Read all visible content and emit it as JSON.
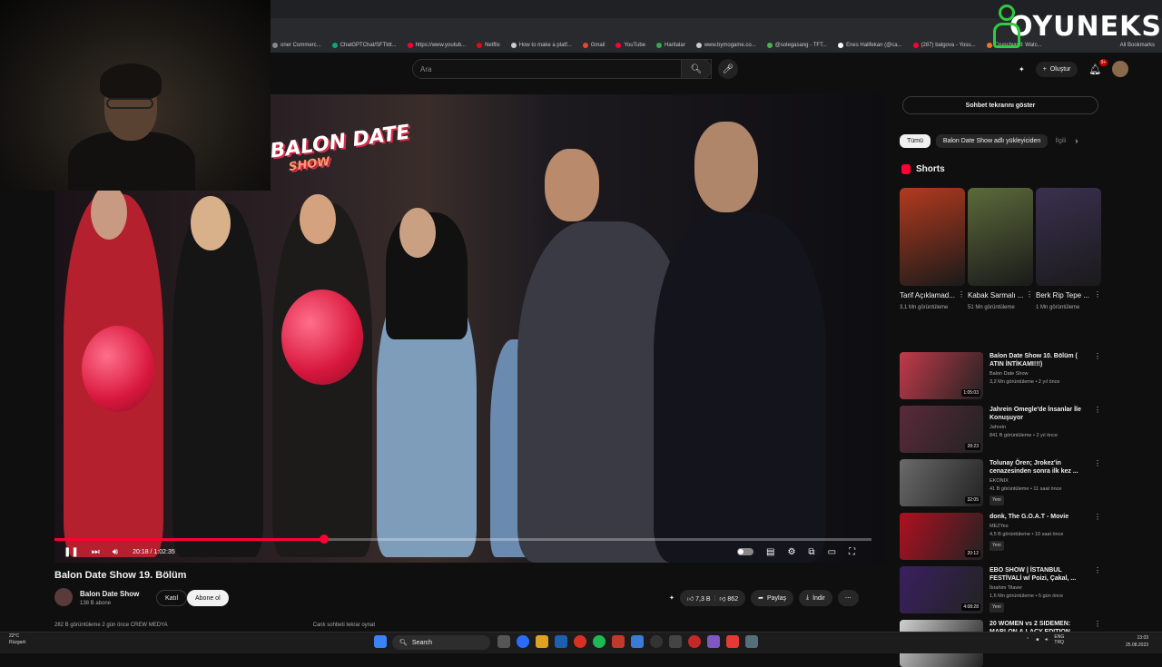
{
  "bookmarks": [
    {
      "label": "oner Commerc...",
      "color": "#888888"
    },
    {
      "label": "ChatGPTChat/SFTktt...",
      "color": "#10a37f"
    },
    {
      "label": "https://www.youtub...",
      "color": "#ff0033"
    },
    {
      "label": "Netflix",
      "color": "#e50914"
    },
    {
      "label": "How to make a platf...",
      "color": "#cccccc"
    },
    {
      "label": "Gmail",
      "color": "#ea4335"
    },
    {
      "label": "YouTube",
      "color": "#ff0033"
    },
    {
      "label": "Haritalar",
      "color": "#34a853"
    },
    {
      "label": "www.bymogame.co...",
      "color": "#cccccc"
    },
    {
      "label": "@solegasang - TFT...",
      "color": "#4caf50"
    },
    {
      "label": "Enes Halifekan (@ca...",
      "color": "#ffffff"
    },
    {
      "label": "(287) balgova - Yosu...",
      "color": "#ff0033"
    },
    {
      "label": "Crunchyroll: Watc...",
      "color": "#f47521"
    }
  ],
  "bookmarks_all": "All Bookmarks",
  "logo": {
    "text": "OYUNEKS",
    "accent": "#2ecc40"
  },
  "masthead": {
    "search_placeholder": "Ara",
    "create_label": "Oluştur",
    "notif_count": "9+"
  },
  "player": {
    "show_logo": "BALON DATE",
    "show_logo_sub": "SHOW",
    "time": "20:18 / 1:02:35",
    "progress": 0.33
  },
  "video": {
    "title": "Balon Date Show 19. Bölüm",
    "channel": "Balon Date Show",
    "subs": "138 B abone",
    "join_label": "Katıl",
    "subscribe_label": "Abone ol",
    "likes": "7,3 B",
    "dislikes": "862",
    "share_label": "Paylaş",
    "download_label": "İndir",
    "desc_views": "282 B görüntüleme 2 gün önce CREW MEDYA",
    "desc_chat": "Canlı sohbeti tekrar oynat"
  },
  "sidebar": {
    "chat_replay": "Sohbet tekrarını göster",
    "chips": [
      "Tümü",
      "Balon Date Show adlı yükleyiciden",
      "İlgili"
    ],
    "shorts_title": "Shorts",
    "shorts": [
      {
        "title": "Tarif Açıklamad...",
        "views": "3,1 Mn görüntüleme",
        "color": "#b33a1e"
      },
      {
        "title": "Kabak Sarmalı ...",
        "views": "51 Mn görüntüleme",
        "color": "#5c6a3a"
      },
      {
        "title": "Berk Rip Tepe ...",
        "views": "1 Mn görüntüleme",
        "color": "#3a3050"
      }
    ],
    "recommendations": [
      {
        "title": "Balon Date Show 10. Bölüm ( ATIN İNTİKAMI!!!)",
        "channel": "Balon Date Show",
        "meta": "3,2 Mn görüntüleme • 2 yıl önce",
        "duration": "1:05:03",
        "new": "",
        "color": "#c23a4a"
      },
      {
        "title": "Jahrein Omegle'de İnsanlar İle Konuşuyor",
        "channel": "Jahrein",
        "meta": "841 B görüntüleme • 2 yıl önce",
        "duration": "28:23",
        "new": "",
        "color": "#5a2a3a"
      },
      {
        "title": "Tolunay Ören; Jrokez'in cenazesinden sonra ilk kez ...",
        "channel": "EKONIX",
        "meta": "41 B görüntüleme • 11 saat önce",
        "duration": "32:05",
        "new": "Yeni",
        "color": "#6a6a6a"
      },
      {
        "title": "donk, The G.O.A.T - Movie",
        "channel": "MEZYes",
        "meta": "4,5 B görüntüleme • 10 saat önce",
        "duration": "20:12",
        "new": "Yeni",
        "color": "#b01020"
      },
      {
        "title": "EBO SHOW | İSTANBUL FESTİVALİ w/ Poizi, Çakal, ...",
        "channel": "İbrahim Tilaver",
        "meta": "1,6 Mn görüntüleme • 5 gün önce",
        "duration": "4:08:28",
        "new": "Yeni",
        "color": "#3a2060"
      },
      {
        "title": "20 WOMEN vs 2 SIDEMEN: MARLON & LACY EDITION",
        "channel": "",
        "meta": "",
        "duration": "",
        "new": "",
        "color": "#d0d0d0"
      }
    ]
  },
  "taskbar": {
    "weather_temp": "22°C",
    "weather_label": "Rüzgarlı",
    "search_label": "Search",
    "lang": "ENG",
    "region": "TRQ",
    "time": "13:03",
    "date": "25.08.2023"
  }
}
